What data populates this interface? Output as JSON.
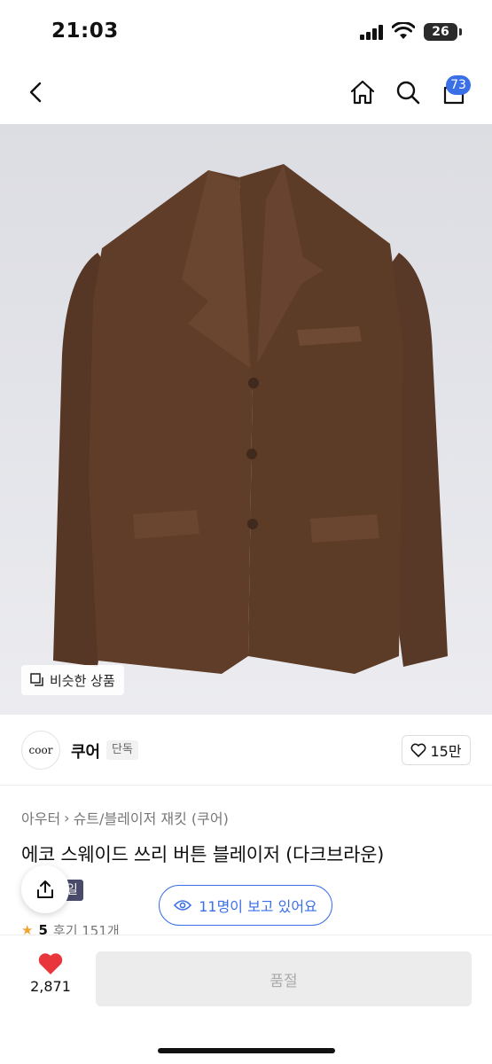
{
  "status_bar": {
    "time": "21:03",
    "battery": "26"
  },
  "nav": {
    "cart_count": "73",
    "icons": [
      "back-icon",
      "home-icon",
      "search-icon",
      "cart-icon"
    ]
  },
  "image": {
    "similar_label": "비슷한 상품"
  },
  "brand": {
    "logo_text": "coor",
    "name": "쿠어",
    "tag": "단독",
    "likes": "15만"
  },
  "product": {
    "breadcrumb": [
      "아우터",
      "슈트/블레이저 재킷 (쿠어)"
    ],
    "title": "에코 스웨이드 쓰리 버튼 블레이저 (다크브라운)",
    "sale_tag": "세일",
    "viewers": "11명이 보고 있어요",
    "rating": "5",
    "reviews": "후기 151개"
  },
  "bottom": {
    "wish_count": "2,871",
    "buy_label": "품절"
  },
  "colors": {
    "accent": "#3a6fe8",
    "heart": "#e8363c",
    "jacket": "#5c3b27"
  }
}
